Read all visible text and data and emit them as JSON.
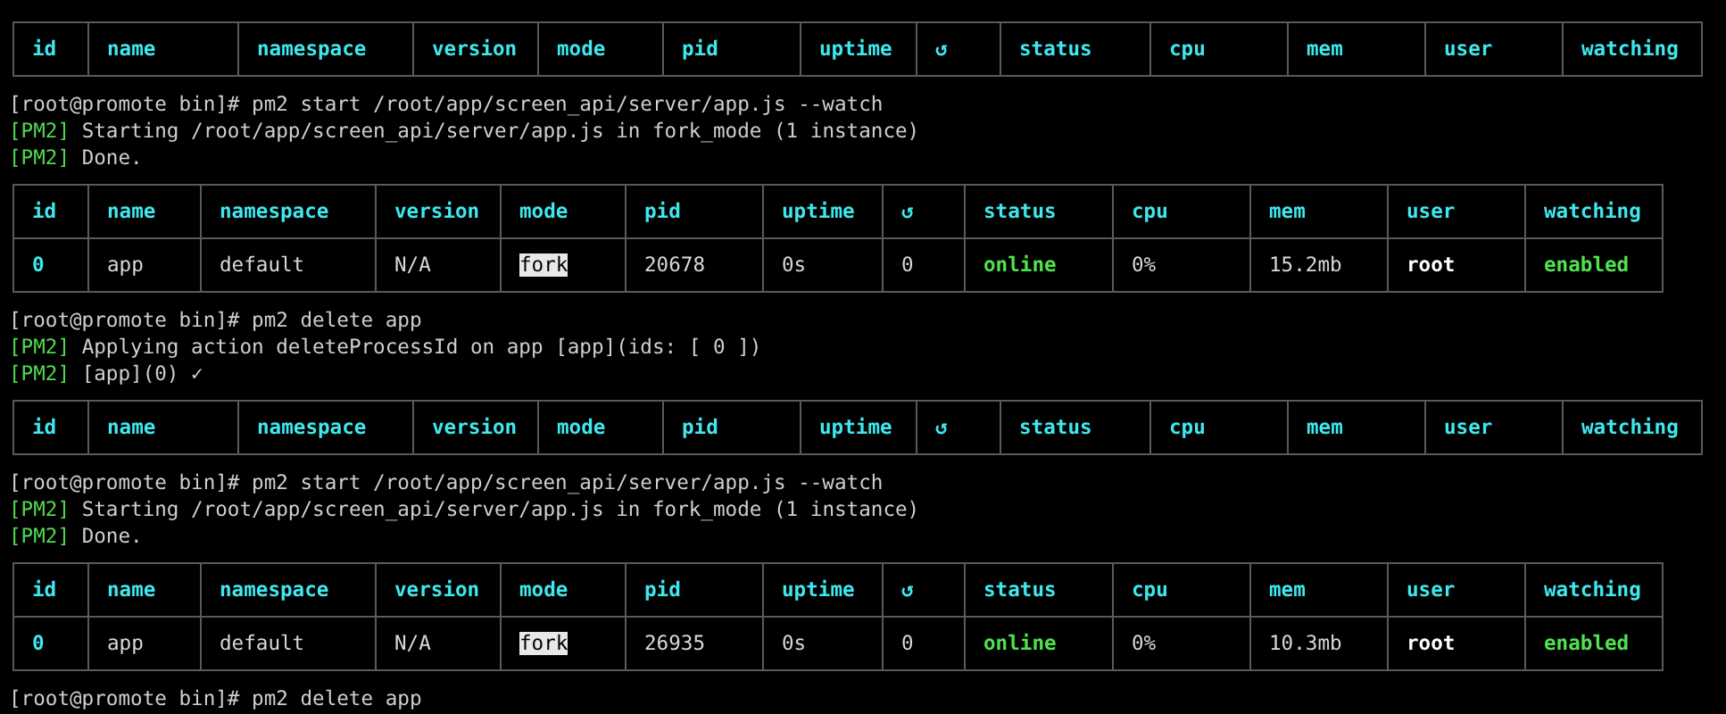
{
  "blocks": [
    {
      "kind": "table",
      "columns": [
        "id",
        "name",
        "namespace",
        "version",
        "mode",
        "pid",
        "uptime",
        "↺",
        "status",
        "cpu",
        "mem",
        "user",
        "watching"
      ]
    },
    {
      "kind": "prompt",
      "text": "[root@promote bin]# pm2 start /root/app/screen_api/server/app.js --watch"
    },
    {
      "kind": "log",
      "tag": "[PM2]",
      "text": "Starting /root/app/screen_api/server/app.js in fork_mode (1 instance)"
    },
    {
      "kind": "log",
      "tag": "[PM2]",
      "text": "Done."
    },
    {
      "kind": "table",
      "columns": [
        "id",
        "name",
        "namespace",
        "version",
        "mode",
        "pid",
        "uptime",
        "↺",
        "status",
        "cpu",
        "mem",
        "user",
        "watching"
      ],
      "rows": [
        [
          "0",
          "app",
          "default",
          "N/A",
          "fork",
          "20678",
          "0s",
          "0",
          "online",
          "0%",
          "15.2mb",
          "root",
          "enabled"
        ]
      ]
    },
    {
      "kind": "prompt",
      "text": "[root@promote bin]# pm2 delete app"
    },
    {
      "kind": "log",
      "tag": "[PM2]",
      "text": "Applying action deleteProcessId on app [app](ids: [ 0 ])"
    },
    {
      "kind": "log",
      "tag": "[PM2]",
      "text": "[app](0) ✓"
    },
    {
      "kind": "table",
      "columns": [
        "id",
        "name",
        "namespace",
        "version",
        "mode",
        "pid",
        "uptime",
        "↺",
        "status",
        "cpu",
        "mem",
        "user",
        "watching"
      ]
    },
    {
      "kind": "prompt",
      "text": "[root@promote bin]# pm2 start /root/app/screen_api/server/app.js --watch"
    },
    {
      "kind": "log",
      "tag": "[PM2]",
      "text": "Starting /root/app/screen_api/server/app.js in fork_mode (1 instance)"
    },
    {
      "kind": "log",
      "tag": "[PM2]",
      "text": "Done."
    },
    {
      "kind": "table",
      "columns": [
        "id",
        "name",
        "namespace",
        "version",
        "mode",
        "pid",
        "uptime",
        "↺",
        "status",
        "cpu",
        "mem",
        "user",
        "watching"
      ],
      "rows": [
        [
          "0",
          "app",
          "default",
          "N/A",
          "fork",
          "26935",
          "0s",
          "0",
          "online",
          "0%",
          "10.3mb",
          "root",
          "enabled"
        ]
      ]
    },
    {
      "kind": "prompt",
      "text": "[root@promote bin]# pm2 delete app"
    }
  ]
}
